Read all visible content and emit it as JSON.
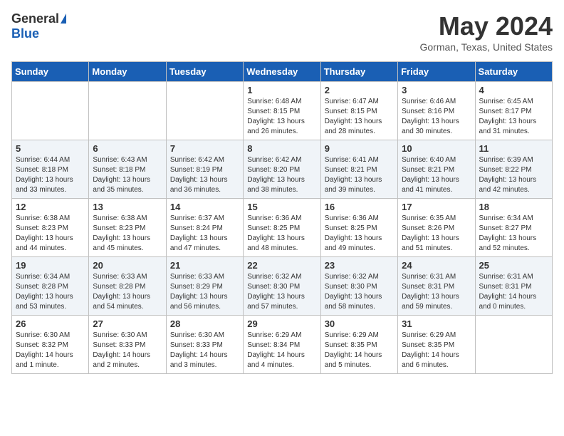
{
  "header": {
    "logo_general": "General",
    "logo_blue": "Blue",
    "month_title": "May 2024",
    "location": "Gorman, Texas, United States"
  },
  "columns": [
    "Sunday",
    "Monday",
    "Tuesday",
    "Wednesday",
    "Thursday",
    "Friday",
    "Saturday"
  ],
  "weeks": [
    [
      {
        "day": "",
        "info": ""
      },
      {
        "day": "",
        "info": ""
      },
      {
        "day": "",
        "info": ""
      },
      {
        "day": "1",
        "info": "Sunrise: 6:48 AM\nSunset: 8:15 PM\nDaylight: 13 hours\nand 26 minutes."
      },
      {
        "day": "2",
        "info": "Sunrise: 6:47 AM\nSunset: 8:15 PM\nDaylight: 13 hours\nand 28 minutes."
      },
      {
        "day": "3",
        "info": "Sunrise: 6:46 AM\nSunset: 8:16 PM\nDaylight: 13 hours\nand 30 minutes."
      },
      {
        "day": "4",
        "info": "Sunrise: 6:45 AM\nSunset: 8:17 PM\nDaylight: 13 hours\nand 31 minutes."
      }
    ],
    [
      {
        "day": "5",
        "info": "Sunrise: 6:44 AM\nSunset: 8:18 PM\nDaylight: 13 hours\nand 33 minutes."
      },
      {
        "day": "6",
        "info": "Sunrise: 6:43 AM\nSunset: 8:18 PM\nDaylight: 13 hours\nand 35 minutes."
      },
      {
        "day": "7",
        "info": "Sunrise: 6:42 AM\nSunset: 8:19 PM\nDaylight: 13 hours\nand 36 minutes."
      },
      {
        "day": "8",
        "info": "Sunrise: 6:42 AM\nSunset: 8:20 PM\nDaylight: 13 hours\nand 38 minutes."
      },
      {
        "day": "9",
        "info": "Sunrise: 6:41 AM\nSunset: 8:21 PM\nDaylight: 13 hours\nand 39 minutes."
      },
      {
        "day": "10",
        "info": "Sunrise: 6:40 AM\nSunset: 8:21 PM\nDaylight: 13 hours\nand 41 minutes."
      },
      {
        "day": "11",
        "info": "Sunrise: 6:39 AM\nSunset: 8:22 PM\nDaylight: 13 hours\nand 42 minutes."
      }
    ],
    [
      {
        "day": "12",
        "info": "Sunrise: 6:38 AM\nSunset: 8:23 PM\nDaylight: 13 hours\nand 44 minutes."
      },
      {
        "day": "13",
        "info": "Sunrise: 6:38 AM\nSunset: 8:23 PM\nDaylight: 13 hours\nand 45 minutes."
      },
      {
        "day": "14",
        "info": "Sunrise: 6:37 AM\nSunset: 8:24 PM\nDaylight: 13 hours\nand 47 minutes."
      },
      {
        "day": "15",
        "info": "Sunrise: 6:36 AM\nSunset: 8:25 PM\nDaylight: 13 hours\nand 48 minutes."
      },
      {
        "day": "16",
        "info": "Sunrise: 6:36 AM\nSunset: 8:25 PM\nDaylight: 13 hours\nand 49 minutes."
      },
      {
        "day": "17",
        "info": "Sunrise: 6:35 AM\nSunset: 8:26 PM\nDaylight: 13 hours\nand 51 minutes."
      },
      {
        "day": "18",
        "info": "Sunrise: 6:34 AM\nSunset: 8:27 PM\nDaylight: 13 hours\nand 52 minutes."
      }
    ],
    [
      {
        "day": "19",
        "info": "Sunrise: 6:34 AM\nSunset: 8:28 PM\nDaylight: 13 hours\nand 53 minutes."
      },
      {
        "day": "20",
        "info": "Sunrise: 6:33 AM\nSunset: 8:28 PM\nDaylight: 13 hours\nand 54 minutes."
      },
      {
        "day": "21",
        "info": "Sunrise: 6:33 AM\nSunset: 8:29 PM\nDaylight: 13 hours\nand 56 minutes."
      },
      {
        "day": "22",
        "info": "Sunrise: 6:32 AM\nSunset: 8:30 PM\nDaylight: 13 hours\nand 57 minutes."
      },
      {
        "day": "23",
        "info": "Sunrise: 6:32 AM\nSunset: 8:30 PM\nDaylight: 13 hours\nand 58 minutes."
      },
      {
        "day": "24",
        "info": "Sunrise: 6:31 AM\nSunset: 8:31 PM\nDaylight: 13 hours\nand 59 minutes."
      },
      {
        "day": "25",
        "info": "Sunrise: 6:31 AM\nSunset: 8:31 PM\nDaylight: 14 hours\nand 0 minutes."
      }
    ],
    [
      {
        "day": "26",
        "info": "Sunrise: 6:30 AM\nSunset: 8:32 PM\nDaylight: 14 hours\nand 1 minute."
      },
      {
        "day": "27",
        "info": "Sunrise: 6:30 AM\nSunset: 8:33 PM\nDaylight: 14 hours\nand 2 minutes."
      },
      {
        "day": "28",
        "info": "Sunrise: 6:30 AM\nSunset: 8:33 PM\nDaylight: 14 hours\nand 3 minutes."
      },
      {
        "day": "29",
        "info": "Sunrise: 6:29 AM\nSunset: 8:34 PM\nDaylight: 14 hours\nand 4 minutes."
      },
      {
        "day": "30",
        "info": "Sunrise: 6:29 AM\nSunset: 8:35 PM\nDaylight: 14 hours\nand 5 minutes."
      },
      {
        "day": "31",
        "info": "Sunrise: 6:29 AM\nSunset: 8:35 PM\nDaylight: 14 hours\nand 6 minutes."
      },
      {
        "day": "",
        "info": ""
      }
    ]
  ]
}
